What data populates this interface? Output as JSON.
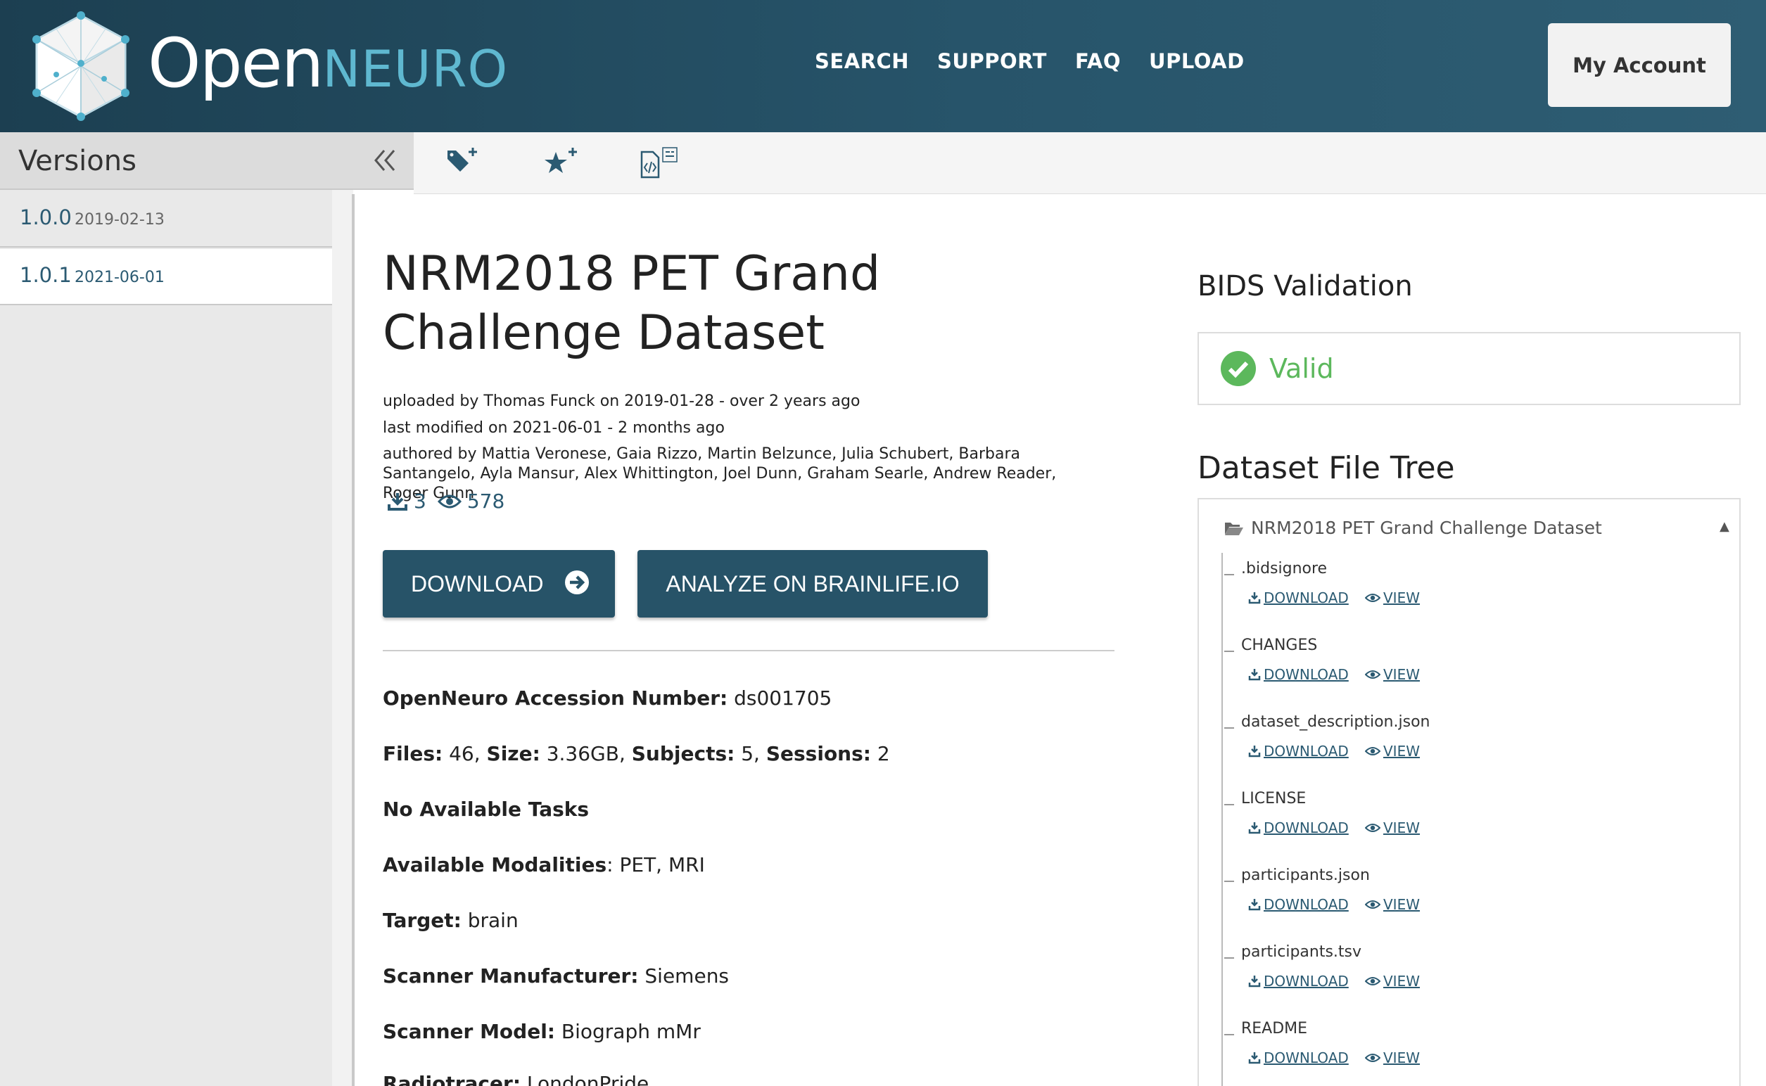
{
  "header": {
    "brand_open": "Open",
    "brand_neuro": "NEURO",
    "nav": [
      "SEARCH",
      "SUPPORT",
      "FAQ",
      "UPLOAD"
    ],
    "account_label": "My Account"
  },
  "sidebar": {
    "title": "Versions",
    "versions": [
      {
        "number": "1.0.0",
        "date": "2019-02-13"
      },
      {
        "number": "1.0.1",
        "date": "2021-06-01"
      }
    ]
  },
  "toolbar": {
    "icons": [
      "tag-plus-icon",
      "star-plus-icon",
      "file-code-icon"
    ]
  },
  "dataset": {
    "title": "NRM2018 PET Grand Challenge Dataset",
    "uploaded": "uploaded by Thomas Funck on 2019-01-28 - over 2 years ago",
    "modified": "last modified on 2021-06-01 - 2 months ago",
    "authors": "authored by Mattia Veronese, Gaia Rizzo, Martin Belzunce, Julia Schubert, Barbara Santangelo, Ayla Mansur, Alex Whittington, Joel Dunn, Graham Searle, Andrew Reader, Roger Gunn",
    "downloads": "3",
    "views": "578",
    "download_label": "DOWNLOAD",
    "analyze_label": "ANALYZE ON BRAINLIFE.IO",
    "accession_label": "OpenNeuro Accession Number:",
    "accession_value": "ds001705",
    "files_label": "Files:",
    "files_value": "46,",
    "size_label": "Size:",
    "size_value": "3.36GB,",
    "subjects_label": "Subjects:",
    "subjects_value": "5,",
    "sessions_label": "Sessions:",
    "sessions_value": "2",
    "tasks": "No Available Tasks",
    "modalities_label": "Available Modalities",
    "modalities_value": ": PET, MRI",
    "target_label": "Target:",
    "target_value": "brain",
    "manufacturer_label": "Scanner Manufacturer:",
    "manufacturer_value": "Siemens",
    "model_label": "Scanner Model:",
    "model_value": "Biograph mMr",
    "radiotracer_label": "Radiotracer:",
    "radiotracer_value": "LondonPride"
  },
  "validation": {
    "title": "BIDS Validation",
    "status": "Valid",
    "status_color": "#5cb85c"
  },
  "file_tree": {
    "title": "Dataset File Tree",
    "root": "NRM2018 PET Grand Challenge Dataset",
    "download_label": "DOWNLOAD",
    "view_label": "VIEW",
    "files": [
      ".bidsignore",
      "CHANGES",
      "dataset_description.json",
      "LICENSE",
      "participants.json",
      "participants.tsv",
      "README"
    ]
  },
  "colors": {
    "header_bg": "#1c3f51",
    "accent": "#275368",
    "link": "#2b5a72",
    "brand_neuro": "#5fb8d0"
  }
}
